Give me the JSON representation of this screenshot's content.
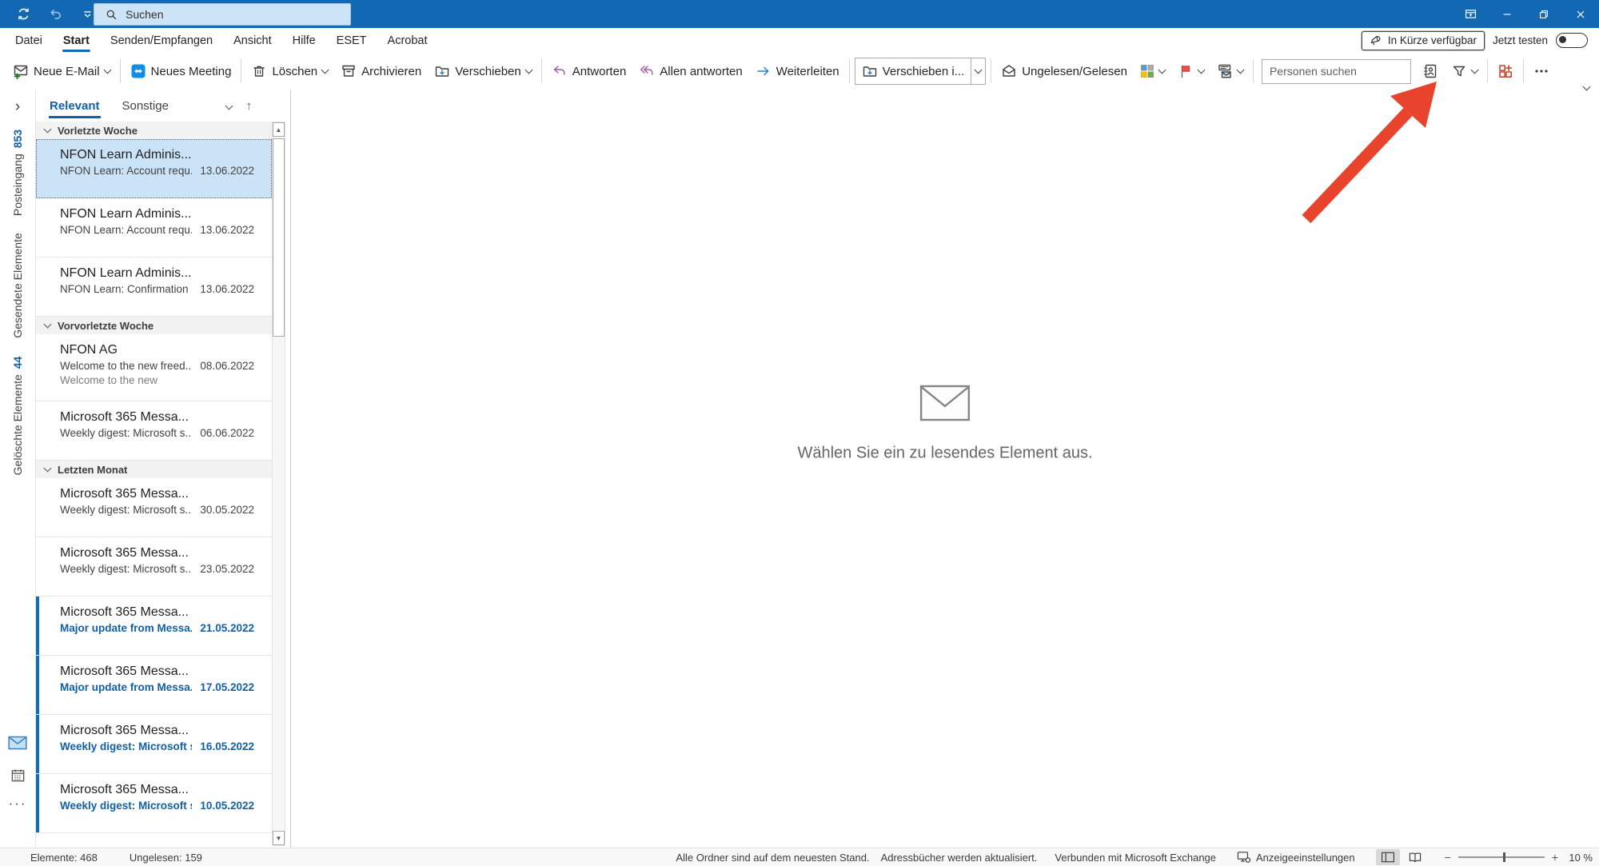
{
  "titlebar": {
    "search_placeholder": "Suchen"
  },
  "menu": {
    "tabs": [
      "Datei",
      "Start",
      "Senden/Empfangen",
      "Ansicht",
      "Hilfe",
      "ESET",
      "Acrobat"
    ],
    "active": "Start"
  },
  "coming_soon": {
    "button": "In Kürze verfügbar",
    "try": "Jetzt testen",
    "toggle_state": "off"
  },
  "ribbon": {
    "items": [
      {
        "type": "button",
        "name": "new-email",
        "icon": "new-mail",
        "label": "Neue E-Mail",
        "chevron": true
      },
      {
        "type": "sep"
      },
      {
        "type": "button",
        "name": "new-meeting",
        "icon": "teamviewer",
        "label": "Neues Meeting"
      },
      {
        "type": "sep"
      },
      {
        "type": "button",
        "name": "delete",
        "icon": "trash",
        "label": "Löschen",
        "chevron": true
      },
      {
        "type": "button",
        "name": "archive",
        "icon": "archive",
        "label": "Archivieren"
      },
      {
        "type": "button",
        "name": "move",
        "icon": "move-folder",
        "label": "Verschieben",
        "chevron": true
      },
      {
        "type": "sep"
      },
      {
        "type": "button",
        "name": "reply",
        "icon": "reply",
        "label": "Antworten"
      },
      {
        "type": "button",
        "name": "reply-all",
        "icon": "reply-all",
        "label": "Allen antworten"
      },
      {
        "type": "button",
        "name": "forward",
        "icon": "forward",
        "label": "Weiterleiten"
      },
      {
        "type": "sep"
      },
      {
        "type": "gallery",
        "name": "quick-steps",
        "icon": "move-folder",
        "label": "Verschieben i...",
        "chevron": true
      },
      {
        "type": "sep"
      },
      {
        "type": "button",
        "name": "unread-read",
        "icon": "envelope-open",
        "label": "Ungelesen/Gelesen"
      },
      {
        "type": "button",
        "name": "categorize",
        "icon": "categorize",
        "label": "",
        "chevron": true
      },
      {
        "type": "button",
        "name": "follow-up",
        "icon": "flag",
        "label": "",
        "chevron": true
      },
      {
        "type": "button",
        "name": "rules",
        "icon": "rules",
        "label": "",
        "chevron": true
      },
      {
        "type": "sep"
      },
      {
        "type": "input",
        "name": "search-people",
        "placeholder": "Personen suchen"
      },
      {
        "type": "button",
        "name": "address-book",
        "icon": "address-book",
        "label": ""
      },
      {
        "type": "button",
        "name": "filter-email",
        "icon": "filter",
        "label": "",
        "chevron": true
      },
      {
        "type": "sep"
      },
      {
        "type": "button",
        "name": "get-addins",
        "icon": "addins",
        "label": ""
      },
      {
        "type": "sep"
      },
      {
        "type": "button",
        "name": "more-commands",
        "icon": "ellipsis",
        "label": ""
      }
    ]
  },
  "folder_pane": {
    "items": [
      {
        "label": "Posteingang",
        "count": "853"
      },
      {
        "label": "Gesendete Elemente",
        "count": ""
      },
      {
        "label": "Gelöschte Elemente",
        "count": "44"
      }
    ]
  },
  "mail_list": {
    "tabs": [
      {
        "label": "Relevant",
        "active": true
      },
      {
        "label": "Sonstige",
        "active": false
      }
    ],
    "groups": [
      {
        "label": "Vorletzte Woche",
        "emails": [
          {
            "sender": "NFON Learn Adminis...",
            "subject": "NFON Learn: Account requ...",
            "date": "13.06.2022",
            "selected": true,
            "unread": false
          },
          {
            "sender": "NFON Learn Adminis...",
            "subject": "NFON Learn: Account requ...",
            "date": "13.06.2022",
            "selected": false,
            "unread": false
          },
          {
            "sender": "NFON Learn Adminis...",
            "subject": "NFON Learn: Confirmation ...",
            "date": "13.06.2022",
            "selected": false,
            "unread": false
          }
        ]
      },
      {
        "label": "Vorvorletzte Woche",
        "emails": [
          {
            "sender": "NFON AG",
            "subject": "Welcome to the new freed...",
            "date": "08.06.2022",
            "preview": "Welcome to the new",
            "selected": false,
            "unread": false
          },
          {
            "sender": "Microsoft 365 Messa...",
            "subject": "Weekly digest: Microsoft s...",
            "date": "06.06.2022",
            "selected": false,
            "unread": false
          }
        ]
      },
      {
        "label": "Letzten Monat",
        "emails": [
          {
            "sender": "Microsoft 365 Messa...",
            "subject": "Weekly digest: Microsoft s...",
            "date": "30.05.2022",
            "selected": false,
            "unread": false
          },
          {
            "sender": "Microsoft 365 Messa...",
            "subject": "Weekly digest: Microsoft s...",
            "date": "23.05.2022",
            "selected": false,
            "unread": false
          },
          {
            "sender": "Microsoft 365 Messa...",
            "subject": "Major update from Messa...",
            "date": "21.05.2022",
            "selected": false,
            "unread": true
          },
          {
            "sender": "Microsoft 365 Messa...",
            "subject": "Major update from Messa...",
            "date": "17.05.2022",
            "selected": false,
            "unread": true
          },
          {
            "sender": "Microsoft 365 Messa...",
            "subject": "Weekly digest: Microsoft s...",
            "date": "16.05.2022",
            "selected": false,
            "unread": true
          },
          {
            "sender": "Microsoft 365 Messa...",
            "subject": "Weekly digest: Microsoft s...",
            "date": "10.05.2022",
            "selected": false,
            "unread": true
          }
        ]
      }
    ]
  },
  "reading_pane": {
    "empty_message": "Wählen Sie ein zu lesendes Element aus."
  },
  "status_bar": {
    "items_count": "Elemente: 468",
    "unread_count": "Ungelesen: 159",
    "sync_status": "Alle Ordner sind auf dem neuesten Stand.",
    "address_books": "Adressbücher werden aktualisiert.",
    "connection": "Verbunden mit Microsoft Exchange",
    "display_settings": "Anzeigeeinstellungen",
    "zoom_level": "10 %"
  },
  "annotation": {
    "type": "arrow",
    "points_to": "get-addins-button",
    "color": "#E8432C"
  },
  "colors": {
    "titlebar": "#1268B3",
    "accent": "#0F6CBD",
    "unread_text": "#1160A8",
    "selected_item_bg": "#CBE3F7",
    "annotation_arrow": "#E8432C",
    "addins_icon": "#C7472E",
    "flag": "#E8504A",
    "teamviewer": "#0E8EE9",
    "categorize": [
      "#5B9BD5",
      "#ABABAB",
      "#FFC000",
      "#70AD47"
    ]
  }
}
